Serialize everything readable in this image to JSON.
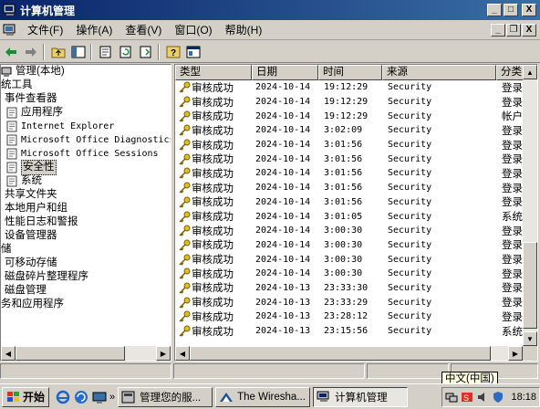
{
  "window": {
    "title": "计算机管理",
    "controls": {
      "minimize": "_",
      "maximize": "□",
      "close": "X"
    }
  },
  "menu": [
    {
      "label": "文件(F)",
      "key": "file"
    },
    {
      "label": "操作(A)",
      "key": "action"
    },
    {
      "label": "查看(V)",
      "key": "view"
    },
    {
      "label": "窗口(O)",
      "key": "window"
    },
    {
      "label": "帮助(H)",
      "key": "help"
    }
  ],
  "mdi_controls": {
    "minimize": "_",
    "restore": "❐",
    "close": "X"
  },
  "toolbar": {
    "buttons": [
      "back-icon",
      "forward-icon",
      "up-folder-icon",
      "show-hide-tree-icon",
      "properties-icon",
      "refresh-icon",
      "export-list-icon",
      "help-icon",
      "console-icon"
    ]
  },
  "tree": {
    "items": [
      {
        "label": "管理(本地)",
        "indent": 0,
        "icon": "computer-icon"
      },
      {
        "label": "统工具",
        "indent": 0,
        "icon": ""
      },
      {
        "label": "事件查看器",
        "indent": 4,
        "icon": ""
      },
      {
        "label": "应用程序",
        "indent": 6,
        "icon": "log-icon"
      },
      {
        "label": "Internet Explorer",
        "indent": 6,
        "icon": "log-icon",
        "mono": true
      },
      {
        "label": "Microsoft Office Diagnostics",
        "indent": 6,
        "icon": "log-icon",
        "mono": true
      },
      {
        "label": "Microsoft Office Sessions",
        "indent": 6,
        "icon": "log-icon",
        "mono": true
      },
      {
        "label": "安全性",
        "indent": 6,
        "icon": "log-icon",
        "selected": true
      },
      {
        "label": "系统",
        "indent": 6,
        "icon": "log-icon"
      },
      {
        "label": "共享文件夹",
        "indent": 4,
        "icon": ""
      },
      {
        "label": "本地用户和组",
        "indent": 4,
        "icon": ""
      },
      {
        "label": "性能日志和警报",
        "indent": 4,
        "icon": ""
      },
      {
        "label": "设备管理器",
        "indent": 4,
        "icon": ""
      },
      {
        "label": "储",
        "indent": 0,
        "icon": ""
      },
      {
        "label": "可移动存储",
        "indent": 4,
        "icon": ""
      },
      {
        "label": "磁盘碎片整理程序",
        "indent": 4,
        "icon": ""
      },
      {
        "label": "磁盘管理",
        "indent": 4,
        "icon": ""
      },
      {
        "label": "务和应用程序",
        "indent": 0,
        "icon": ""
      }
    ]
  },
  "list": {
    "columns": [
      "类型",
      "日期",
      "时间",
      "来源",
      "分类"
    ],
    "rows": [
      {
        "type": "审核成功",
        "date": "2024-10-14",
        "time": "19:12:29",
        "source": "Security",
        "category": "登录"
      },
      {
        "type": "审核成功",
        "date": "2024-10-14",
        "time": "19:12:29",
        "source": "Security",
        "category": "登录"
      },
      {
        "type": "审核成功",
        "date": "2024-10-14",
        "time": "19:12:29",
        "source": "Security",
        "category": "帐户"
      },
      {
        "type": "审核成功",
        "date": "2024-10-14",
        "time": "3:02:09",
        "source": "Security",
        "category": "登录"
      },
      {
        "type": "审核成功",
        "date": "2024-10-14",
        "time": "3:01:56",
        "source": "Security",
        "category": "登录"
      },
      {
        "type": "审核成功",
        "date": "2024-10-14",
        "time": "3:01:56",
        "source": "Security",
        "category": "登录"
      },
      {
        "type": "审核成功",
        "date": "2024-10-14",
        "time": "3:01:56",
        "source": "Security",
        "category": "登录"
      },
      {
        "type": "审核成功",
        "date": "2024-10-14",
        "time": "3:01:56",
        "source": "Security",
        "category": "登录"
      },
      {
        "type": "审核成功",
        "date": "2024-10-14",
        "time": "3:01:56",
        "source": "Security",
        "category": "登录"
      },
      {
        "type": "审核成功",
        "date": "2024-10-14",
        "time": "3:01:05",
        "source": "Security",
        "category": "系统"
      },
      {
        "type": "审核成功",
        "date": "2024-10-14",
        "time": "3:00:30",
        "source": "Security",
        "category": "登录"
      },
      {
        "type": "审核成功",
        "date": "2024-10-14",
        "time": "3:00:30",
        "source": "Security",
        "category": "登录"
      },
      {
        "type": "审核成功",
        "date": "2024-10-14",
        "time": "3:00:30",
        "source": "Security",
        "category": "登录"
      },
      {
        "type": "审核成功",
        "date": "2024-10-14",
        "time": "3:00:30",
        "source": "Security",
        "category": "登录"
      },
      {
        "type": "审核成功",
        "date": "2024-10-13",
        "time": "23:33:30",
        "source": "Security",
        "category": "登录"
      },
      {
        "type": "审核成功",
        "date": "2024-10-13",
        "time": "23:33:29",
        "source": "Security",
        "category": "登录"
      },
      {
        "type": "审核成功",
        "date": "2024-10-13",
        "time": "23:28:12",
        "source": "Security",
        "category": "登录"
      },
      {
        "type": "审核成功",
        "date": "2024-10-13",
        "time": "23:15:56",
        "source": "Security",
        "category": "系统"
      }
    ]
  },
  "taskbar": {
    "start_label": "开始",
    "quick_launch": [
      "ie-icon",
      "outlook-icon",
      "desktop-icon"
    ],
    "overflow": "»",
    "tasks": [
      {
        "label": "管理您的服...",
        "icon": "server-icon",
        "active": false
      },
      {
        "label": "The Wiresha...",
        "icon": "wireshark-icon",
        "active": false
      },
      {
        "label": "计算机管理",
        "icon": "computer-icon",
        "active": true
      }
    ],
    "clock": "18:18"
  },
  "ime_tooltip": "中文(中国)",
  "colors": {
    "title_start": "#0a246a",
    "title_end": "#3a6ea5",
    "face": "#d4d0c8",
    "key_icon": "#d8c000"
  }
}
